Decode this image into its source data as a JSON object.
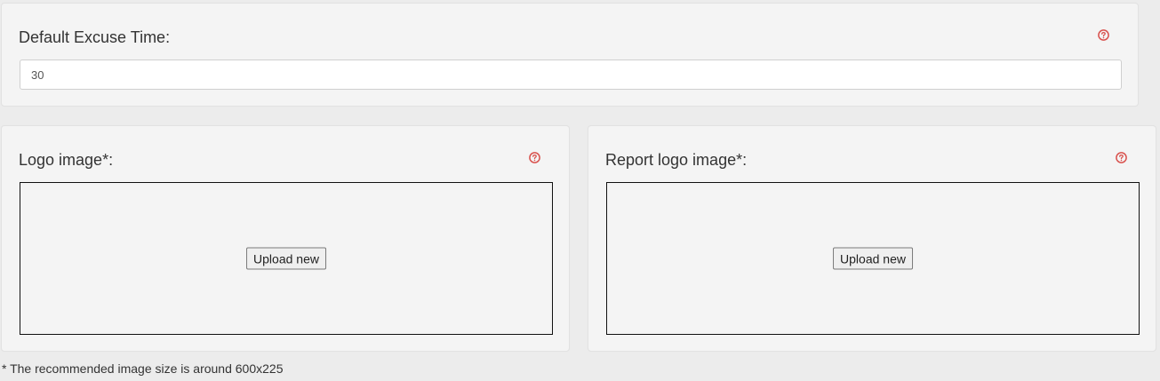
{
  "excuse_time": {
    "label": "Default Excuse Time:",
    "value": "30",
    "help_icon": "question-circle-icon"
  },
  "logo_image": {
    "label": "Logo image*:",
    "upload_label": "Upload new",
    "help_icon": "question-circle-icon"
  },
  "report_logo_image": {
    "label": "Report logo image*:",
    "upload_label": "Upload new",
    "help_icon": "question-circle-icon"
  },
  "footnote": "* The recommended image size is around 600x225",
  "colors": {
    "help_icon": "#d9534f",
    "page_background": "#ececec",
    "panel_background": "#f4f4f4"
  }
}
